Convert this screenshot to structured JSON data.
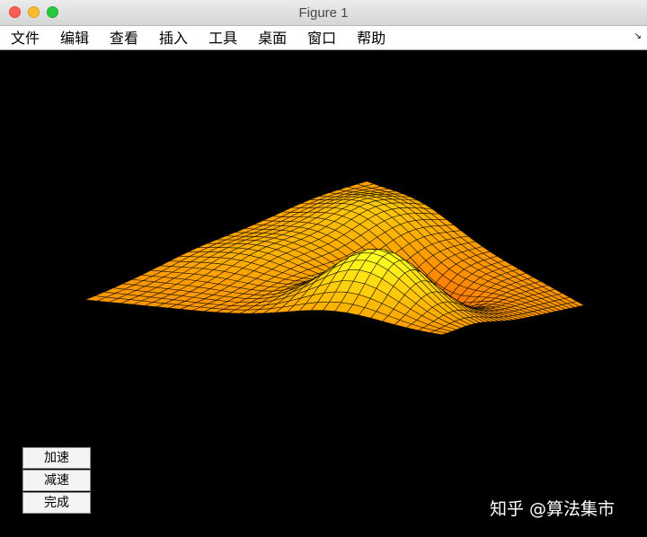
{
  "window": {
    "title": "Figure 1",
    "controls": [
      "close",
      "minimize",
      "maximize"
    ]
  },
  "menubar": {
    "items": [
      "文件",
      "编辑",
      "查看",
      "插入",
      "工具",
      "桌面",
      "窗口",
      "帮助"
    ],
    "corner_icon": "undock-arrow-icon"
  },
  "figure": {
    "background": "#000000",
    "surface_colormap": [
      "#ff6a00",
      "#ffb000",
      "#ffff20"
    ],
    "mesh_color": "#000000",
    "buttons": [
      "加速",
      "减速",
      "完成"
    ]
  },
  "watermark": {
    "text": "知乎 @算法集市"
  }
}
